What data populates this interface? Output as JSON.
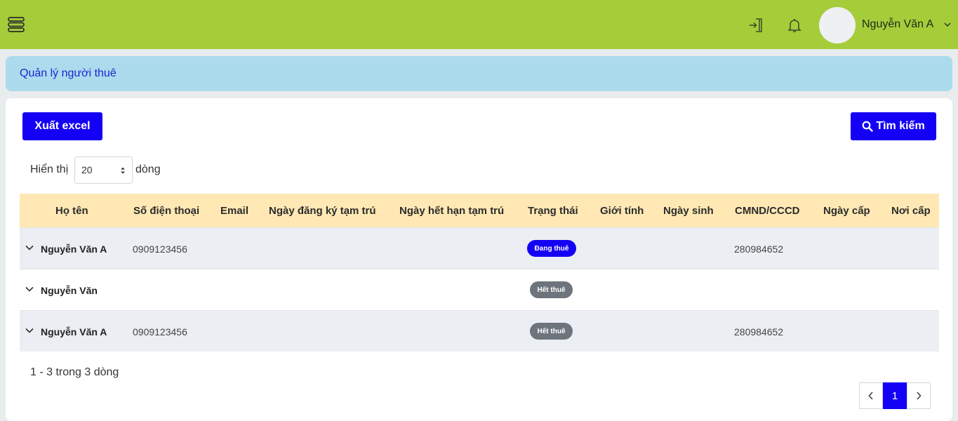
{
  "header": {
    "user_name": "Nguyễn Văn A",
    "icons": [
      "menu-icon",
      "logout-icon",
      "bell-icon",
      "chevron-down-icon"
    ]
  },
  "breadcrumb": {
    "title": "Quản lý người thuê"
  },
  "toolbar": {
    "export_label": "Xuất excel",
    "search_label": "Tìm kiếm"
  },
  "page_size": {
    "prefix": "Hiển thị",
    "value": "20",
    "suffix": "dòng"
  },
  "table": {
    "columns": [
      "Họ tên",
      "Số điện thoại",
      "Email",
      "Ngày đăng ký tạm trú",
      "Ngày hết hạn tạm trú",
      "Trạng thái",
      "Giới tính",
      "Ngày sinh",
      "CMND/CCCD",
      "Ngày cấp",
      "Nơi cấp"
    ],
    "rows": [
      {
        "name": "Nguyễn Văn A",
        "phone": "0909123456",
        "status": "Đang thuê",
        "id_number": "280984652"
      },
      {
        "name": "Nguyễn Văn",
        "phone": "",
        "status": "Hết thuê",
        "id_number": ""
      },
      {
        "name": "Nguyễn Văn A",
        "phone": "0909123456",
        "status": "Hết thuê",
        "id_number": "280984652"
      }
    ]
  },
  "footer": {
    "summary": "1 - 3 trong 3 dòng",
    "current_page": "1"
  },
  "colors": {
    "topbar": "#a5cd39",
    "breadcrumb_bg": "#abdbec",
    "primary": "#1400f5",
    "table_header": "#ffe8b4",
    "badge_ended": "#6e747c"
  }
}
